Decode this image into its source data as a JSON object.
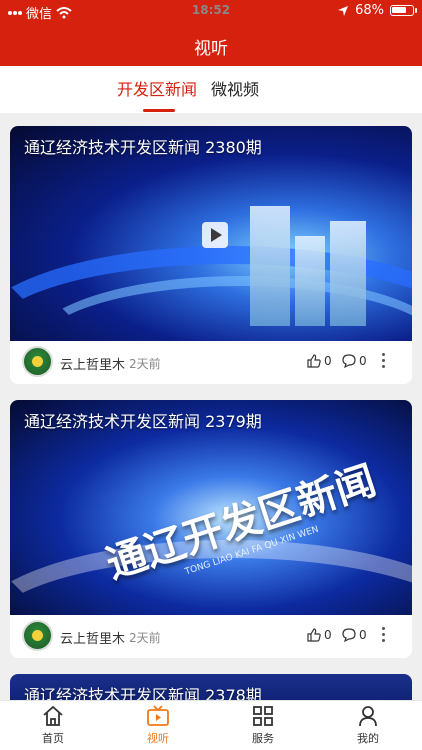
{
  "status": {
    "carrier": "微信",
    "time": "18:52",
    "battery": "68%"
  },
  "header": {
    "title": "视听"
  },
  "tabs": [
    {
      "label": "开发区新闻"
    },
    {
      "label": "微视频"
    }
  ],
  "cards": [
    {
      "title": "通辽经济技术开发区新闻 2380期",
      "source": "云上哲里木",
      "time": "2天前",
      "likes": "0",
      "comments": "0"
    },
    {
      "title": "通辽经济技术开发区新闻 2379期",
      "source": "云上哲里木",
      "time": "2天前",
      "likes": "0",
      "comments": "0",
      "thumb_text": "通辽开发区新闻",
      "thumb_subtext": "TONG LIAO KAI FA QU XIN WEN"
    },
    {
      "title": "通辽经济技术开发区新闻 2378期"
    }
  ],
  "nav": [
    {
      "label": "首页"
    },
    {
      "label": "视听"
    },
    {
      "label": "服务"
    },
    {
      "label": "我的"
    }
  ],
  "colors": {
    "brand": "#d6210f",
    "active_nav": "#f07a1b"
  }
}
